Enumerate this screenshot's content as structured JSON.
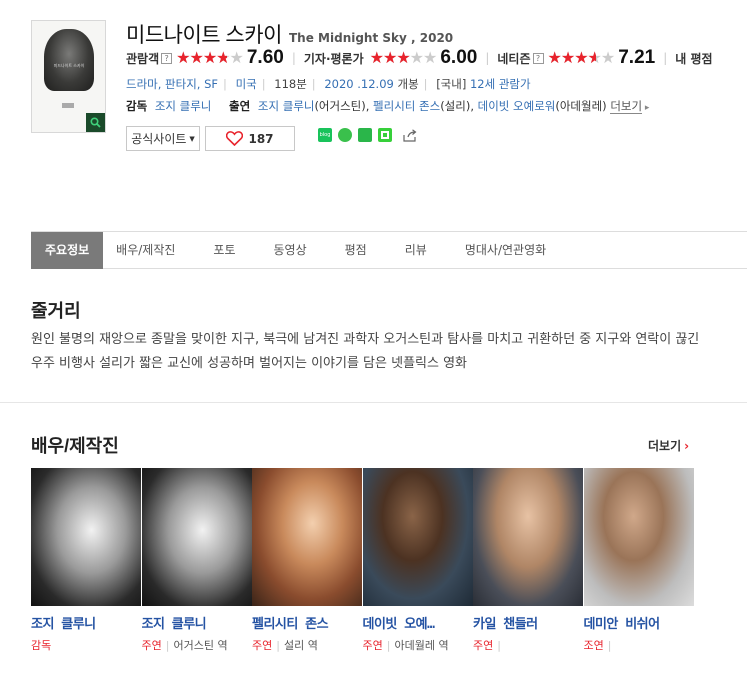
{
  "movie": {
    "title_kr": "미드나이트 스카이",
    "title_en": "The Midnight Sky , 2020",
    "poster_title": "미드나이트 스카이"
  },
  "ratings": [
    {
      "label": "관람객",
      "score": "7.60",
      "value": 7.6
    },
    {
      "label": "기자·평론가",
      "score": "6.00",
      "value": 6.0
    },
    {
      "label": "네티즌",
      "score": "7.21",
      "value": 7.21
    },
    {
      "label": "내 평점",
      "score": "",
      "value": 0
    }
  ],
  "info": {
    "genre": "드라마, 판타지, SF",
    "country": "미국",
    "runtime": "118분",
    "release": "2020 .12.09",
    "release_suffix": "개봉",
    "region": "[국내]",
    "age": "12세 관람가"
  },
  "crew": {
    "director_label": "감독",
    "director": "조지 클루니",
    "cast_label": "출연",
    "cast_text": "조지 클루니",
    "cast_role1": "(어거스틴),",
    "cast2": "펠리시티 존스",
    "cast_role2": "(설리),",
    "cast3": "데이빗 오예로워",
    "cast_role3": "(아데월레)",
    "more": "더보기"
  },
  "buttons": {
    "official_site": "공식사이트",
    "like_count": "187"
  },
  "tabs": [
    "주요정보",
    "배우/제작진",
    "포토",
    "동영상",
    "평점",
    "리뷰",
    "명대사/연관영화"
  ],
  "synopsis": {
    "title": "줄거리",
    "text": "원인 불명의 재앙으로 종말을 맞이한 지구, 북극에 남겨진 과학자 오거스틴과 탐사를 마치고 귀환하던 중 지구와 연락이 끊긴 우주 비행사 설리가 짧은 교신에 성공하며 벌어지는 이야기를 담은 넷플릭스 영화"
  },
  "cast_section": {
    "title": "배우/제작진",
    "more": "더보기",
    "people": [
      {
        "name": "조지 클루니",
        "role": "감독",
        "character": ""
      },
      {
        "name": "조지 클루니",
        "role": "주연",
        "character": "어거스틴 역"
      },
      {
        "name": "펠리시티 존스",
        "role": "주연",
        "character": "설리 역"
      },
      {
        "name": "데이빗 오예…",
        "role": "주연",
        "character": "아데월레 역"
      },
      {
        "name": "카일 챈들러",
        "role": "주연",
        "character": ""
      },
      {
        "name": "데미안 비쉬어",
        "role": "조연",
        "character": ""
      }
    ]
  },
  "colors": {
    "accent_red": "#e8232c",
    "link_blue": "#356fb3",
    "tab_active": "#7a7a7a"
  }
}
